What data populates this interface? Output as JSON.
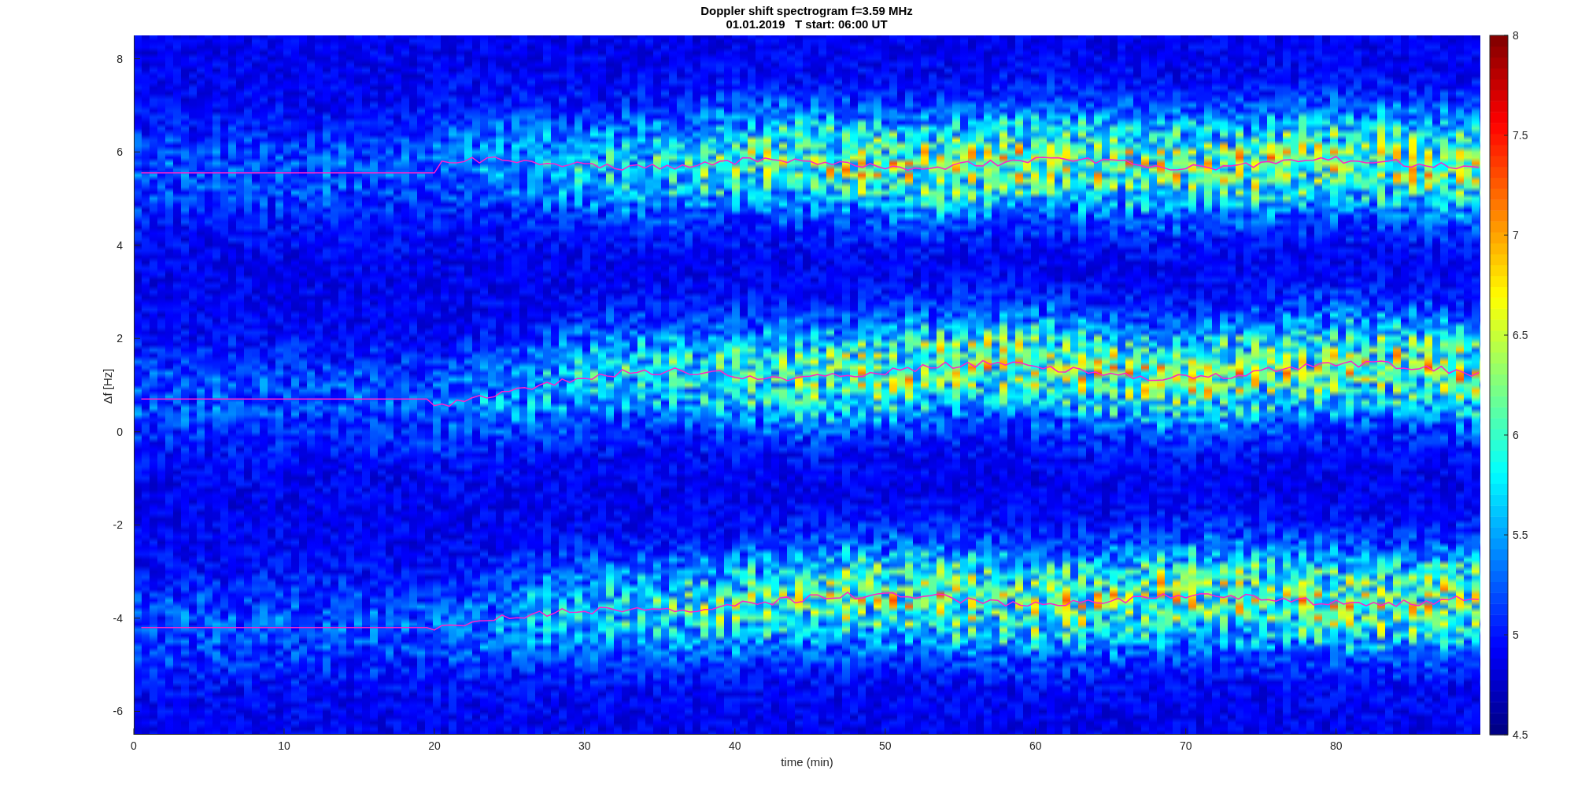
{
  "figure": {
    "title": [
      "Doppler shift spectrogram f=3.59 MHz",
      "01.01.2019   T start: 06:00 UT"
    ]
  },
  "plot": {
    "xlabel": "time (min)",
    "ylabel": "Δf [Hz]",
    "xticks": [
      "0",
      "10",
      "20",
      "30",
      "40",
      "50",
      "60",
      "70",
      "80"
    ],
    "yticks": [
      "8",
      "6",
      "4",
      "2",
      "0",
      "-2",
      "-4",
      "-6"
    ]
  },
  "colorbar": {
    "ticks": [
      "8",
      "7.5",
      "7",
      "6.5",
      "6",
      "5.5",
      "5",
      "4.5"
    ]
  }
}
